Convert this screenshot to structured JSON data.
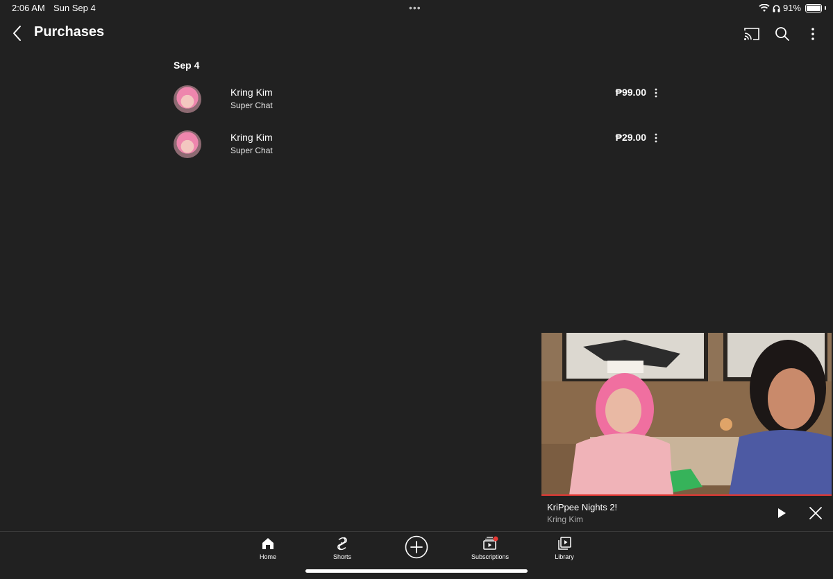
{
  "status_bar": {
    "time": "2:06 AM",
    "date": "Sun Sep 4",
    "battery_percent": "91%",
    "battery_level": 0.91
  },
  "header": {
    "title": "Purchases",
    "icons": [
      "back-icon",
      "cast-icon",
      "search-icon",
      "more-vert-icon"
    ]
  },
  "purchases": {
    "date_heading": "Sep 4",
    "items": [
      {
        "name": "Kring Kim",
        "type": "Super Chat",
        "price": "₱99.00"
      },
      {
        "name": "Kring Kim",
        "type": "Super Chat",
        "price": "₱29.00"
      }
    ]
  },
  "mini_player": {
    "title": "KriPpee Nights 2!",
    "channel": "Kring Kim",
    "progress": 1.0
  },
  "bottom_nav": {
    "items": [
      {
        "label": "Home",
        "icon": "home-icon"
      },
      {
        "label": "Shorts",
        "icon": "shorts-icon"
      },
      {
        "label": "",
        "icon": "create-plus-icon"
      },
      {
        "label": "Subscriptions",
        "icon": "subscriptions-icon"
      },
      {
        "label": "Library",
        "icon": "library-icon"
      }
    ]
  },
  "colors": {
    "background": "#212121",
    "accent_red": "#e53935",
    "text_primary": "#ffffff",
    "text_secondary": "#aaaaaa"
  }
}
